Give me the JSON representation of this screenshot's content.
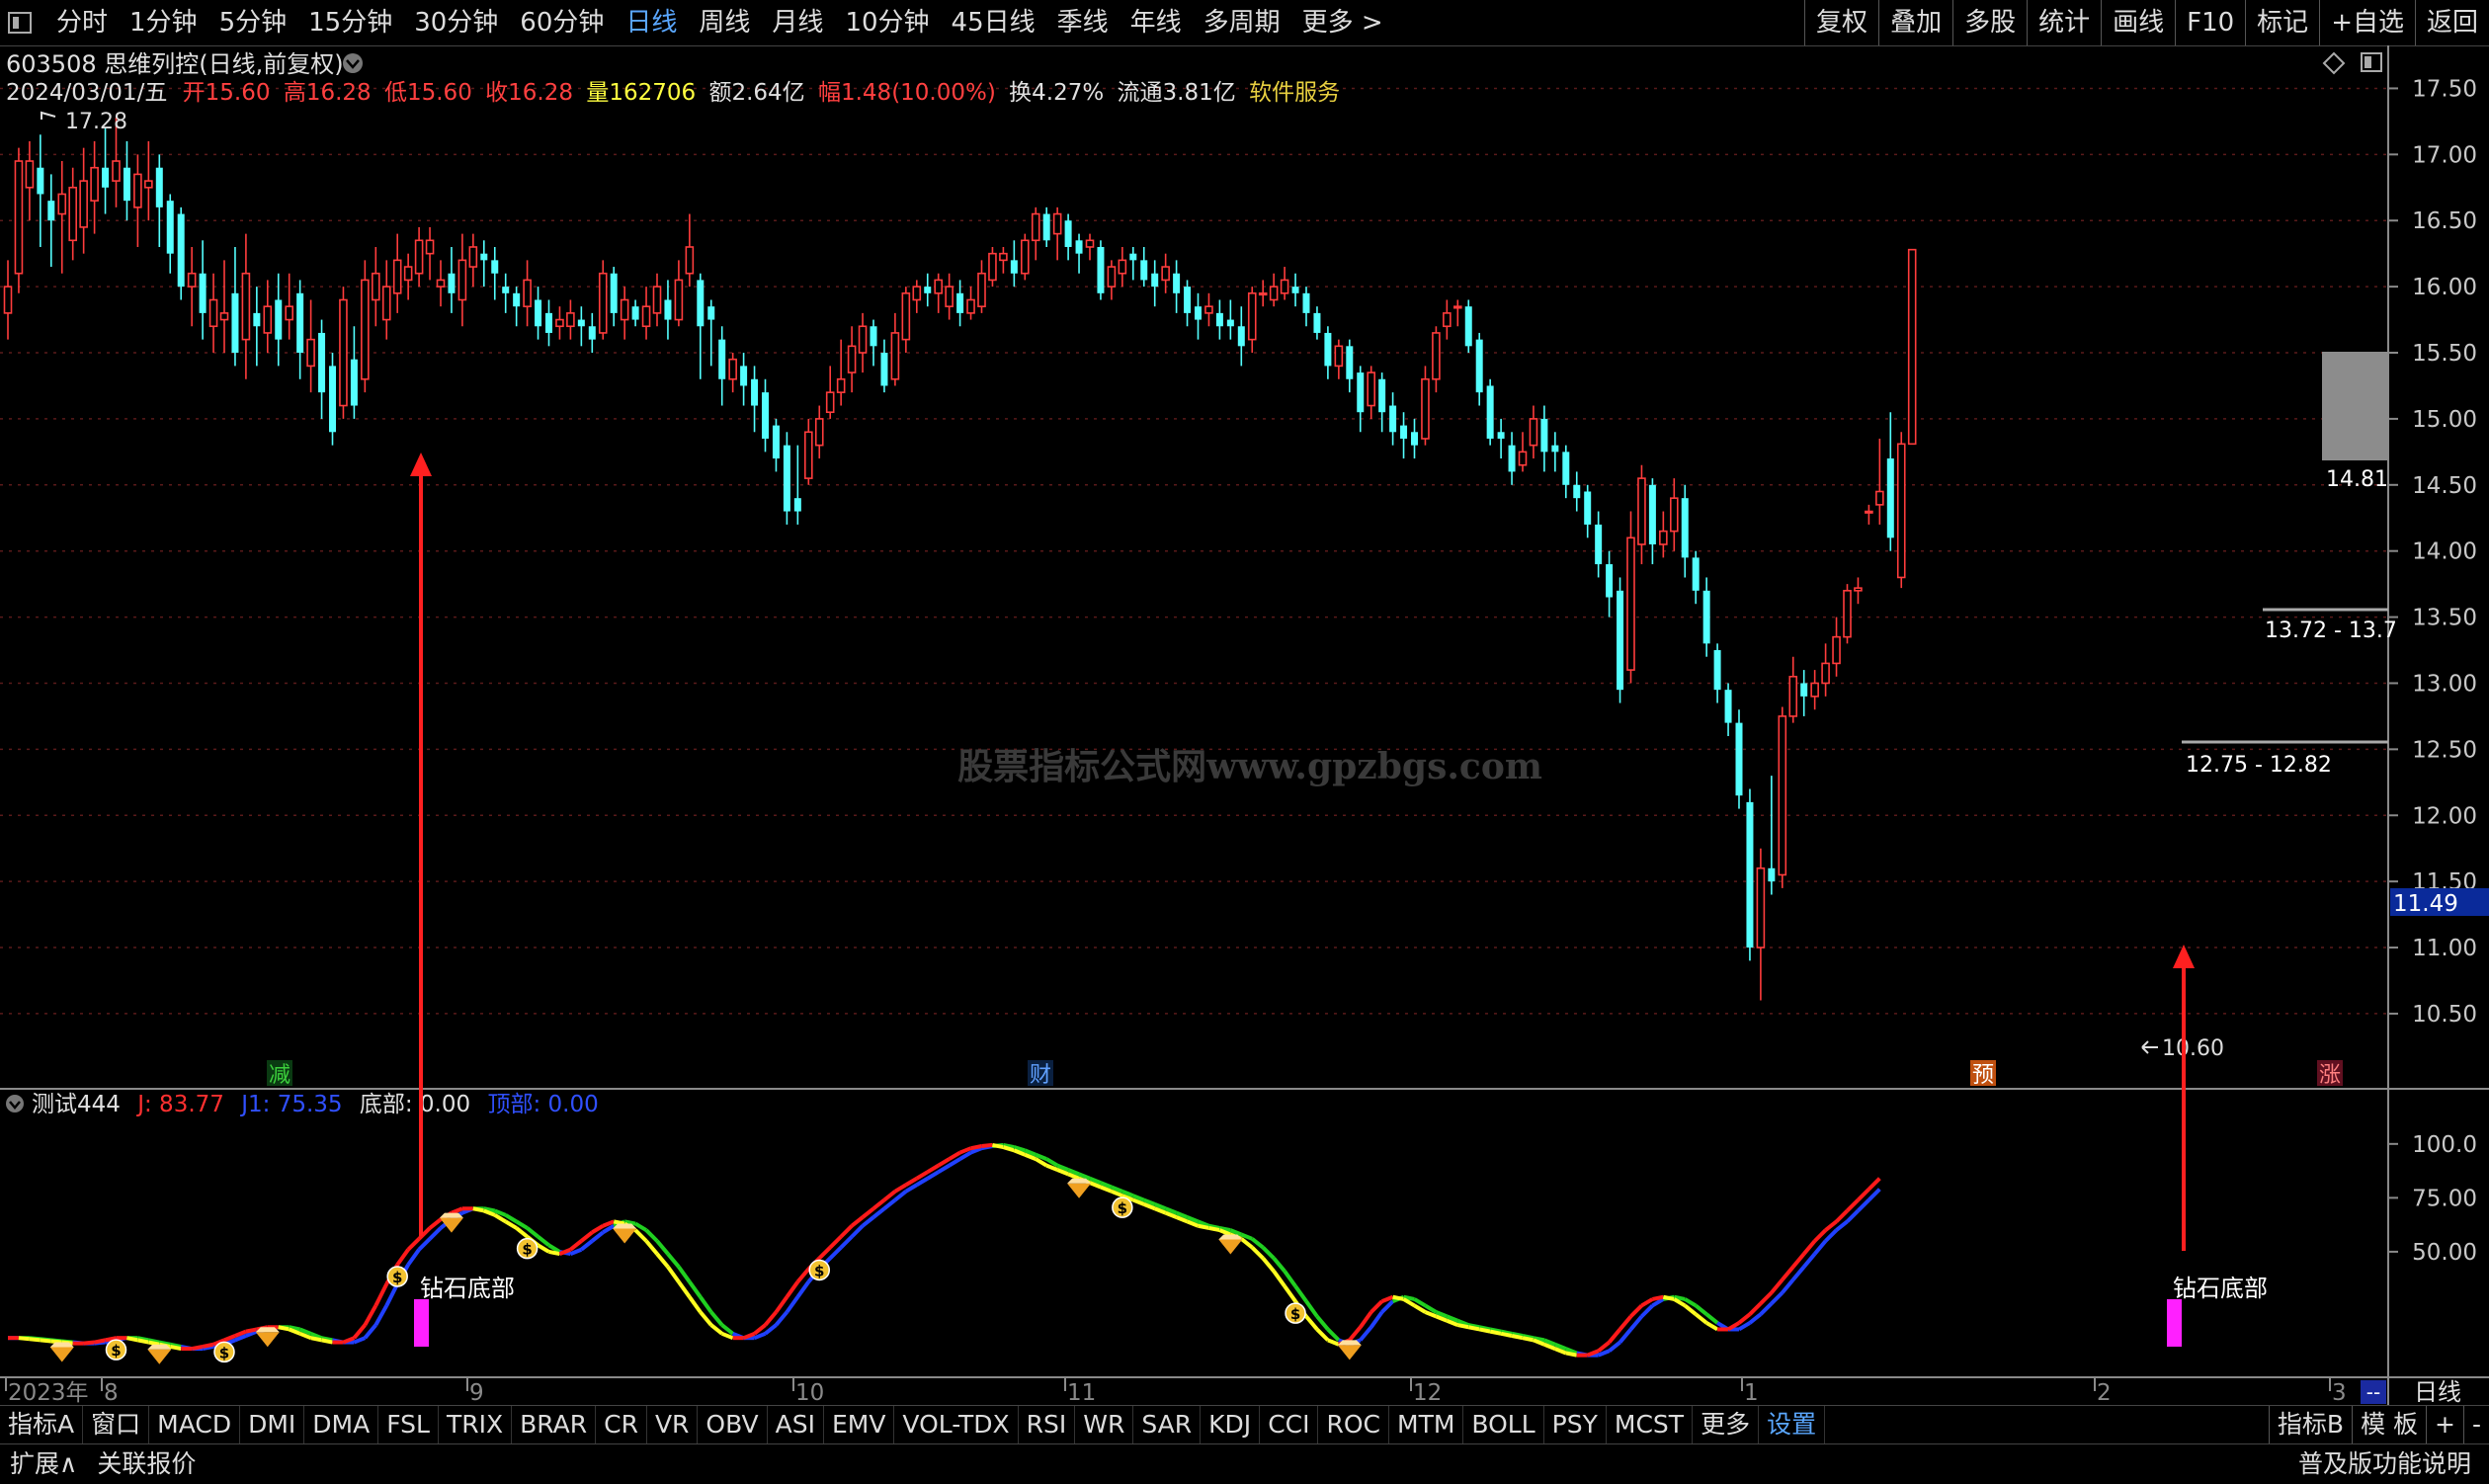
{
  "toolbar": {
    "periods": [
      "分时",
      "1分钟",
      "5分钟",
      "15分钟",
      "30分钟",
      "60分钟",
      "日线",
      "周线",
      "月线",
      "10分钟",
      "45日线",
      "季线",
      "年线",
      "多周期",
      "更多 >"
    ],
    "active_period": "日线",
    "right": [
      "复权",
      "叠加",
      "多股",
      "统计",
      "画线",
      "F10",
      "标记",
      "+自选",
      "返回"
    ]
  },
  "stock": {
    "title": "603508 思维列控(日线,前复权)",
    "date": "2024/03/01/五",
    "open_label": "开",
    "open": "15.60",
    "high_label": "高",
    "high": "16.28",
    "low_label": "低",
    "low": "15.60",
    "close_label": "收",
    "close": "16.28",
    "vol_label": "量",
    "vol": "162706",
    "amount": "额2.64亿",
    "change": "幅1.48(10.00%)",
    "turnover": "换4.27%",
    "float_cap": "流通3.81亿",
    "service": "软件服务"
  },
  "price_axis": {
    "ticks": [
      "17.50",
      "17.00",
      "16.50",
      "16.00",
      "15.50",
      "15.00",
      "14.50",
      "14.00",
      "13.50",
      "13.00",
      "12.50",
      "12.00",
      "11.50",
      "11.00",
      "10.50"
    ],
    "min": 10.35,
    "max": 17.75,
    "current": "11.49"
  },
  "annotations": {
    "high_marker": "17.28",
    "low_marker": "10.60",
    "box_label": "14.81",
    "range1": "13.72 - 13.7",
    "range2": "12.75 - 12.82",
    "watermark": "股票指标公式网www.gpzbgs.com",
    "event_tags": [
      "减",
      "财",
      "预",
      "涨"
    ]
  },
  "indicator": {
    "name": "测试444",
    "j_label": "J: 83.77",
    "j1_label": "J1: 75.35",
    "bottom_label": "底部: 0.00",
    "top_label": "顶部: 0.00",
    "signal": "钻石底部",
    "ticks": [
      "100.0",
      "75.00",
      "50.00"
    ],
    "min": 0,
    "max": 110
  },
  "time_axis": {
    "labels": [
      "2023年",
      "8",
      "9",
      "10",
      "11",
      "12",
      "1",
      "2",
      "3"
    ],
    "corner": "日线"
  },
  "indicator_tabs": [
    "指标A",
    "窗口",
    "MACD",
    "DMI",
    "DMA",
    "FSL",
    "TRIX",
    "BRAR",
    "CR",
    "VR",
    "OBV",
    "ASI",
    "EMV",
    "VOL-TDX",
    "RSI",
    "WR",
    "SAR",
    "KDJ",
    "CCI",
    "ROC",
    "MTM",
    "BOLL",
    "PSY",
    "MCST",
    "更多",
    "设置"
  ],
  "indicator_tabs_right": [
    "指标B",
    "模 板",
    "+",
    "-"
  ],
  "status": {
    "left": [
      "扩展∧",
      "关联报价"
    ],
    "right": "普及版功能说明"
  },
  "colors": {
    "up": "#ff3c3c",
    "down": "#54ffff",
    "ma_red": "#ff1a1a",
    "ma_blue": "#2040ff",
    "ma_yellow": "#ffff20",
    "ma_green": "#20d020",
    "signal": "#ff20ff",
    "arrow": "#ff2020"
  },
  "candles": [
    [
      15.8,
      16.0,
      16.2,
      15.6
    ],
    [
      16.1,
      16.95,
      17.05,
      15.95
    ],
    [
      16.75,
      16.95,
      17.1,
      16.5
    ],
    [
      16.9,
      16.7,
      17.15,
      16.3
    ],
    [
      16.65,
      16.5,
      16.85,
      16.15
    ],
    [
      16.55,
      16.7,
      16.95,
      16.1
    ],
    [
      16.35,
      16.75,
      16.9,
      16.2
    ],
    [
      16.45,
      16.8,
      17.05,
      16.25
    ],
    [
      16.65,
      16.9,
      17.1,
      16.4
    ],
    [
      16.9,
      16.75,
      17.2,
      16.55
    ],
    [
      16.8,
      16.95,
      17.28,
      16.6
    ],
    [
      16.9,
      16.65,
      17.1,
      16.5
    ],
    [
      16.6,
      16.85,
      17.0,
      16.3
    ],
    [
      16.75,
      16.8,
      17.1,
      16.5
    ],
    [
      16.9,
      16.6,
      17.0,
      16.3
    ],
    [
      16.65,
      16.25,
      16.7,
      16.1
    ],
    [
      16.55,
      16.0,
      16.6,
      15.9
    ],
    [
      16.0,
      16.1,
      16.3,
      15.7
    ],
    [
      16.1,
      15.8,
      16.35,
      15.6
    ],
    [
      15.7,
      15.9,
      16.1,
      15.5
    ],
    [
      15.75,
      15.8,
      16.2,
      15.5
    ],
    [
      15.95,
      15.5,
      16.3,
      15.4
    ],
    [
      15.6,
      16.1,
      16.4,
      15.3
    ],
    [
      15.8,
      15.7,
      16.0,
      15.4
    ],
    [
      15.65,
      15.85,
      16.05,
      15.5
    ],
    [
      15.9,
      15.6,
      16.1,
      15.4
    ],
    [
      15.75,
      15.85,
      16.1,
      15.6
    ],
    [
      15.95,
      15.5,
      16.05,
      15.3
    ],
    [
      15.4,
      15.6,
      15.9,
      15.2
    ],
    [
      15.65,
      15.2,
      15.75,
      15.0
    ],
    [
      15.4,
      14.9,
      15.5,
      14.8
    ],
    [
      15.1,
      15.9,
      16.0,
      15.0
    ],
    [
      15.45,
      15.1,
      15.7,
      15.0
    ],
    [
      15.3,
      16.05,
      16.2,
      15.2
    ],
    [
      15.9,
      16.1,
      16.3,
      15.7
    ],
    [
      15.75,
      16.0,
      16.2,
      15.6
    ],
    [
      15.95,
      16.2,
      16.4,
      15.8
    ],
    [
      16.05,
      16.15,
      16.25,
      15.9
    ],
    [
      16.1,
      16.35,
      16.45,
      16.0
    ],
    [
      16.25,
      16.35,
      16.45,
      16.05
    ],
    [
      16.0,
      16.05,
      16.2,
      15.85
    ],
    [
      16.1,
      15.95,
      16.3,
      15.8
    ],
    [
      15.9,
      16.2,
      16.4,
      15.7
    ],
    [
      16.15,
      16.3,
      16.4,
      16.0
    ],
    [
      16.25,
      16.2,
      16.35,
      16.0
    ],
    [
      16.2,
      16.1,
      16.3,
      15.9
    ],
    [
      16.0,
      15.95,
      16.1,
      15.8
    ],
    [
      15.95,
      15.85,
      16.0,
      15.7
    ],
    [
      15.85,
      16.05,
      16.2,
      15.7
    ],
    [
      15.9,
      15.7,
      16.0,
      15.6
    ],
    [
      15.8,
      15.65,
      15.9,
      15.55
    ],
    [
      15.7,
      15.75,
      15.85,
      15.6
    ],
    [
      15.7,
      15.8,
      15.9,
      15.6
    ],
    [
      15.75,
      15.7,
      15.85,
      15.55
    ],
    [
      15.7,
      15.6,
      15.8,
      15.5
    ],
    [
      15.65,
      16.1,
      16.2,
      15.6
    ],
    [
      16.1,
      15.8,
      16.15,
      15.7
    ],
    [
      15.75,
      15.9,
      16.0,
      15.6
    ],
    [
      15.85,
      15.75,
      15.9,
      15.7
    ],
    [
      15.7,
      15.85,
      16.0,
      15.6
    ],
    [
      15.8,
      16.0,
      16.1,
      15.7
    ],
    [
      15.9,
      15.75,
      16.05,
      15.6
    ],
    [
      15.75,
      16.05,
      16.2,
      15.7
    ],
    [
      16.1,
      16.3,
      16.55,
      16.0
    ],
    [
      16.05,
      15.7,
      16.1,
      15.3
    ],
    [
      15.85,
      15.75,
      15.9,
      15.4
    ],
    [
      15.6,
      15.3,
      15.7,
      15.1
    ],
    [
      15.3,
      15.45,
      15.5,
      15.2
    ],
    [
      15.4,
      15.25,
      15.5,
      15.1
    ],
    [
      15.3,
      15.1,
      15.4,
      14.9
    ],
    [
      15.2,
      14.85,
      15.3,
      14.75
    ],
    [
      14.95,
      14.7,
      15.0,
      14.6
    ],
    [
      14.8,
      14.3,
      14.9,
      14.2
    ],
    [
      14.4,
      14.3,
      14.8,
      14.2
    ],
    [
      14.55,
      14.9,
      15.0,
      14.5
    ],
    [
      14.8,
      15.0,
      15.1,
      14.7
    ],
    [
      15.05,
      15.2,
      15.4,
      15.0
    ],
    [
      15.2,
      15.3,
      15.6,
      15.1
    ],
    [
      15.35,
      15.55,
      15.7,
      15.2
    ],
    [
      15.5,
      15.7,
      15.8,
      15.35
    ],
    [
      15.7,
      15.55,
      15.75,
      15.4
    ],
    [
      15.5,
      15.25,
      15.6,
      15.2
    ],
    [
      15.3,
      15.65,
      15.8,
      15.25
    ],
    [
      15.6,
      15.95,
      16.0,
      15.5
    ],
    [
      15.9,
      16.0,
      16.05,
      15.8
    ],
    [
      16.0,
      15.95,
      16.1,
      15.85
    ],
    [
      15.95,
      16.05,
      16.1,
      15.8
    ],
    [
      15.85,
      16.0,
      16.1,
      15.75
    ],
    [
      15.95,
      15.8,
      16.05,
      15.7
    ],
    [
      15.8,
      15.9,
      16.0,
      15.75
    ],
    [
      15.85,
      16.1,
      16.2,
      15.8
    ],
    [
      16.05,
      16.25,
      16.3,
      16.0
    ],
    [
      16.2,
      16.25,
      16.3,
      16.1
    ],
    [
      16.2,
      16.1,
      16.35,
      16.0
    ],
    [
      16.1,
      16.35,
      16.4,
      16.05
    ],
    [
      16.35,
      16.55,
      16.6,
      16.2
    ],
    [
      16.55,
      16.35,
      16.6,
      16.3
    ],
    [
      16.4,
      16.55,
      16.6,
      16.2
    ],
    [
      16.5,
      16.3,
      16.55,
      16.2
    ],
    [
      16.35,
      16.25,
      16.4,
      16.1
    ],
    [
      16.3,
      16.35,
      16.4,
      16.2
    ],
    [
      16.3,
      15.95,
      16.35,
      15.9
    ],
    [
      16.0,
      16.15,
      16.2,
      15.9
    ],
    [
      16.1,
      16.2,
      16.3,
      16.0
    ],
    [
      16.25,
      16.2,
      16.3,
      16.05
    ],
    [
      16.2,
      16.05,
      16.3,
      16.0
    ],
    [
      16.1,
      16.0,
      16.2,
      15.85
    ],
    [
      16.05,
      16.15,
      16.25,
      15.95
    ],
    [
      16.1,
      15.95,
      16.2,
      15.8
    ],
    [
      16.0,
      15.8,
      16.05,
      15.7
    ],
    [
      15.85,
      15.75,
      15.95,
      15.6
    ],
    [
      15.8,
      15.85,
      15.95,
      15.7
    ],
    [
      15.8,
      15.7,
      15.9,
      15.6
    ],
    [
      15.75,
      15.7,
      15.9,
      15.6
    ],
    [
      15.7,
      15.55,
      15.85,
      15.4
    ],
    [
      15.6,
      15.95,
      16.0,
      15.5
    ],
    [
      15.95,
      15.95,
      16.05,
      15.85
    ],
    [
      15.9,
      16.0,
      16.1,
      15.85
    ],
    [
      15.95,
      16.05,
      16.15,
      15.9
    ],
    [
      16.0,
      15.95,
      16.1,
      15.85
    ],
    [
      15.95,
      15.8,
      16.0,
      15.7
    ],
    [
      15.8,
      15.65,
      15.85,
      15.6
    ],
    [
      15.65,
      15.4,
      15.7,
      15.3
    ],
    [
      15.4,
      15.55,
      15.6,
      15.3
    ],
    [
      15.55,
      15.3,
      15.6,
      15.2
    ],
    [
      15.35,
      15.05,
      15.4,
      14.9
    ],
    [
      15.1,
      15.35,
      15.4,
      15.0
    ],
    [
      15.3,
      15.05,
      15.35,
      14.9
    ],
    [
      15.1,
      14.9,
      15.2,
      14.8
    ],
    [
      14.95,
      14.85,
      15.05,
      14.7
    ],
    [
      14.9,
      14.8,
      15.0,
      14.7
    ],
    [
      14.85,
      15.3,
      15.4,
      14.8
    ],
    [
      15.3,
      15.65,
      15.7,
      15.2
    ],
    [
      15.7,
      15.8,
      15.9,
      15.6
    ],
    [
      15.85,
      15.85,
      15.9,
      15.7
    ],
    [
      15.85,
      15.55,
      15.9,
      15.5
    ],
    [
      15.6,
      15.2,
      15.65,
      15.1
    ],
    [
      15.25,
      14.85,
      15.3,
      14.8
    ],
    [
      14.9,
      14.85,
      15.0,
      14.7
    ],
    [
      14.8,
      14.6,
      14.9,
      14.5
    ],
    [
      14.65,
      14.75,
      14.9,
      14.6
    ],
    [
      14.8,
      15.0,
      15.1,
      14.7
    ],
    [
      15.0,
      14.75,
      15.1,
      14.6
    ],
    [
      14.8,
      14.75,
      14.9,
      14.6
    ],
    [
      14.75,
      14.5,
      14.8,
      14.4
    ],
    [
      14.5,
      14.4,
      14.6,
      14.3
    ],
    [
      14.45,
      14.2,
      14.5,
      14.1
    ],
    [
      14.2,
      13.9,
      14.3,
      13.8
    ],
    [
      13.9,
      13.65,
      14.0,
      13.5
    ],
    [
      13.7,
      12.95,
      13.8,
      12.85
    ],
    [
      13.1,
      14.1,
      14.3,
      13.0
    ],
    [
      14.05,
      14.55,
      14.65,
      13.9
    ],
    [
      14.5,
      14.05,
      14.55,
      13.9
    ],
    [
      14.05,
      14.15,
      14.3,
      13.95
    ],
    [
      14.15,
      14.4,
      14.55,
      14.0
    ],
    [
      14.4,
      13.95,
      14.5,
      13.8
    ],
    [
      13.95,
      13.7,
      14.0,
      13.6
    ],
    [
      13.7,
      13.3,
      13.8,
      13.2
    ],
    [
      13.25,
      12.95,
      13.3,
      12.85
    ],
    [
      12.95,
      12.7,
      13.0,
      12.6
    ],
    [
      12.7,
      12.15,
      12.8,
      12.05
    ],
    [
      12.1,
      11.0,
      12.2,
      10.9
    ],
    [
      11.0,
      11.6,
      11.75,
      10.6
    ],
    [
      11.6,
      11.5,
      12.3,
      11.4
    ],
    [
      11.55,
      12.75,
      12.82,
      11.45
    ],
    [
      12.75,
      13.05,
      13.2,
      12.7
    ],
    [
      13.0,
      12.9,
      13.1,
      12.75
    ],
    [
      12.9,
      13.0,
      13.1,
      12.8
    ],
    [
      13.0,
      13.15,
      13.3,
      12.9
    ],
    [
      13.15,
      13.35,
      13.5,
      13.05
    ],
    [
      13.35,
      13.7,
      13.75,
      13.3
    ],
    [
      13.7,
      13.72,
      13.8,
      13.6
    ],
    [
      14.3,
      14.3,
      14.35,
      14.2
    ],
    [
      14.35,
      14.45,
      14.85,
      14.2
    ],
    [
      14.7,
      14.1,
      15.05,
      14.0
    ],
    [
      13.8,
      14.81,
      14.9,
      13.72
    ],
    [
      14.81,
      16.28,
      16.28,
      14.81
    ]
  ],
  "kdj": {
    "j": [
      10,
      10,
      9.5,
      9,
      8.5,
      8,
      7.5,
      7.5,
      8,
      9,
      10,
      10,
      9,
      8,
      7,
      6,
      5,
      5,
      6,
      7,
      9,
      11,
      13,
      14,
      15,
      15,
      14,
      12,
      10,
      9,
      8,
      8,
      10,
      16,
      25,
      35,
      44,
      51,
      56,
      61,
      65,
      68,
      70,
      70,
      69,
      67,
      64,
      61,
      57,
      53,
      50,
      49,
      51,
      55,
      59,
      62,
      64,
      63,
      60,
      55,
      49,
      43,
      36,
      29,
      22,
      16,
      12,
      10,
      10,
      12,
      16,
      22,
      29,
      36,
      42,
      47,
      52,
      57,
      62,
      66,
      70,
      74,
      78,
      81,
      84,
      87,
      90,
      93,
      96,
      98,
      99,
      99.5,
      98.5,
      97,
      95,
      93,
      90,
      88,
      86,
      84,
      82,
      80,
      78,
      76,
      74,
      72,
      70,
      68,
      66,
      64,
      62,
      61,
      60,
      58,
      56,
      52,
      47,
      41,
      34,
      27,
      20,
      14,
      9,
      7,
      9,
      15,
      22,
      27,
      29,
      28,
      25,
      22,
      20,
      18,
      16,
      15,
      14,
      13,
      12,
      11,
      10,
      9,
      7,
      5,
      3,
      2,
      2,
      4,
      8,
      14,
      20,
      25,
      28,
      29,
      28,
      25,
      21,
      17,
      14,
      14,
      17,
      21,
      26,
      31,
      37,
      43,
      49,
      55,
      60,
      64,
      69,
      74,
      79,
      84
    ],
    "j1": [
      10,
      10,
      10,
      9.5,
      9,
      8.5,
      8,
      7.5,
      7.5,
      8,
      9,
      10,
      10,
      9,
      8,
      7,
      6,
      5,
      5,
      6,
      7,
      9,
      11,
      13,
      14,
      15,
      15,
      14,
      12,
      10,
      9,
      8,
      8,
      10,
      16,
      25,
      35,
      44,
      51,
      56,
      61,
      65,
      68,
      70,
      70,
      69,
      67,
      64,
      61,
      57,
      53,
      50,
      49,
      51,
      55,
      59,
      62,
      64,
      63,
      60,
      55,
      49,
      43,
      36,
      29,
      22,
      16,
      12,
      10,
      10,
      12,
      16,
      22,
      29,
      36,
      42,
      47,
      52,
      57,
      62,
      66,
      70,
      74,
      78,
      81,
      84,
      87,
      90,
      93,
      96,
      98,
      99,
      99.5,
      98.5,
      97,
      95,
      93,
      90,
      88,
      86,
      84,
      82,
      80,
      78,
      76,
      74,
      72,
      70,
      68,
      66,
      64,
      62,
      61,
      60,
      58,
      56,
      52,
      47,
      41,
      34,
      27,
      20,
      14,
      9,
      7,
      9,
      15,
      22,
      27,
      29,
      28,
      25,
      22,
      20,
      18,
      16,
      15,
      14,
      13,
      12,
      11,
      10,
      9,
      7,
      5,
      3,
      2,
      2,
      4,
      8,
      14,
      20,
      25,
      28,
      29,
      28,
      25,
      21,
      17,
      14,
      14,
      17,
      21,
      26,
      31,
      37,
      43,
      49,
      55,
      60,
      64,
      69,
      74,
      79
    ]
  }
}
